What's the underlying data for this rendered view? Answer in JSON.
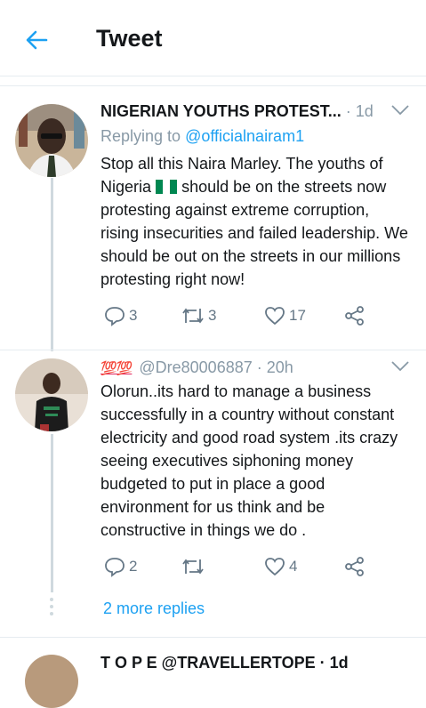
{
  "header": {
    "title": "Tweet",
    "back_icon": "arrow-left-icon"
  },
  "tweet1": {
    "author_name": "NIGERIAN YOUTHS PROTEST...",
    "time": "· 1d",
    "replying_label": "Replying to",
    "replying_handle": "@officialnairam1",
    "text_before_flag": "Stop all this Naira Marley. The youths of Nigeria",
    "text_after_flag": "should be on the streets now protesting against extreme corruption, rising insecurities and failed leadership. We should be out on the streets in our millions protesting right now!",
    "replies": "3",
    "retweets": "3",
    "likes": "17"
  },
  "tweet2": {
    "emoji": "💯💯",
    "handle": "@Dre80006887",
    "time": "· 20h",
    "text": "Olorun..its hard to manage a business successfully in a country without constant electricity and good road system .its crazy seeing executives siphoning money budgeted to put in place a good environment for us think and be constructive in things we do .",
    "replies": "2",
    "retweets": "",
    "likes": "4"
  },
  "more_replies": "2 more replies",
  "tweet3_partial": "T O P E @TRAVELLERTOPE · 1d",
  "colors": {
    "accent": "#1da1f2",
    "flag_green": "#008751"
  }
}
